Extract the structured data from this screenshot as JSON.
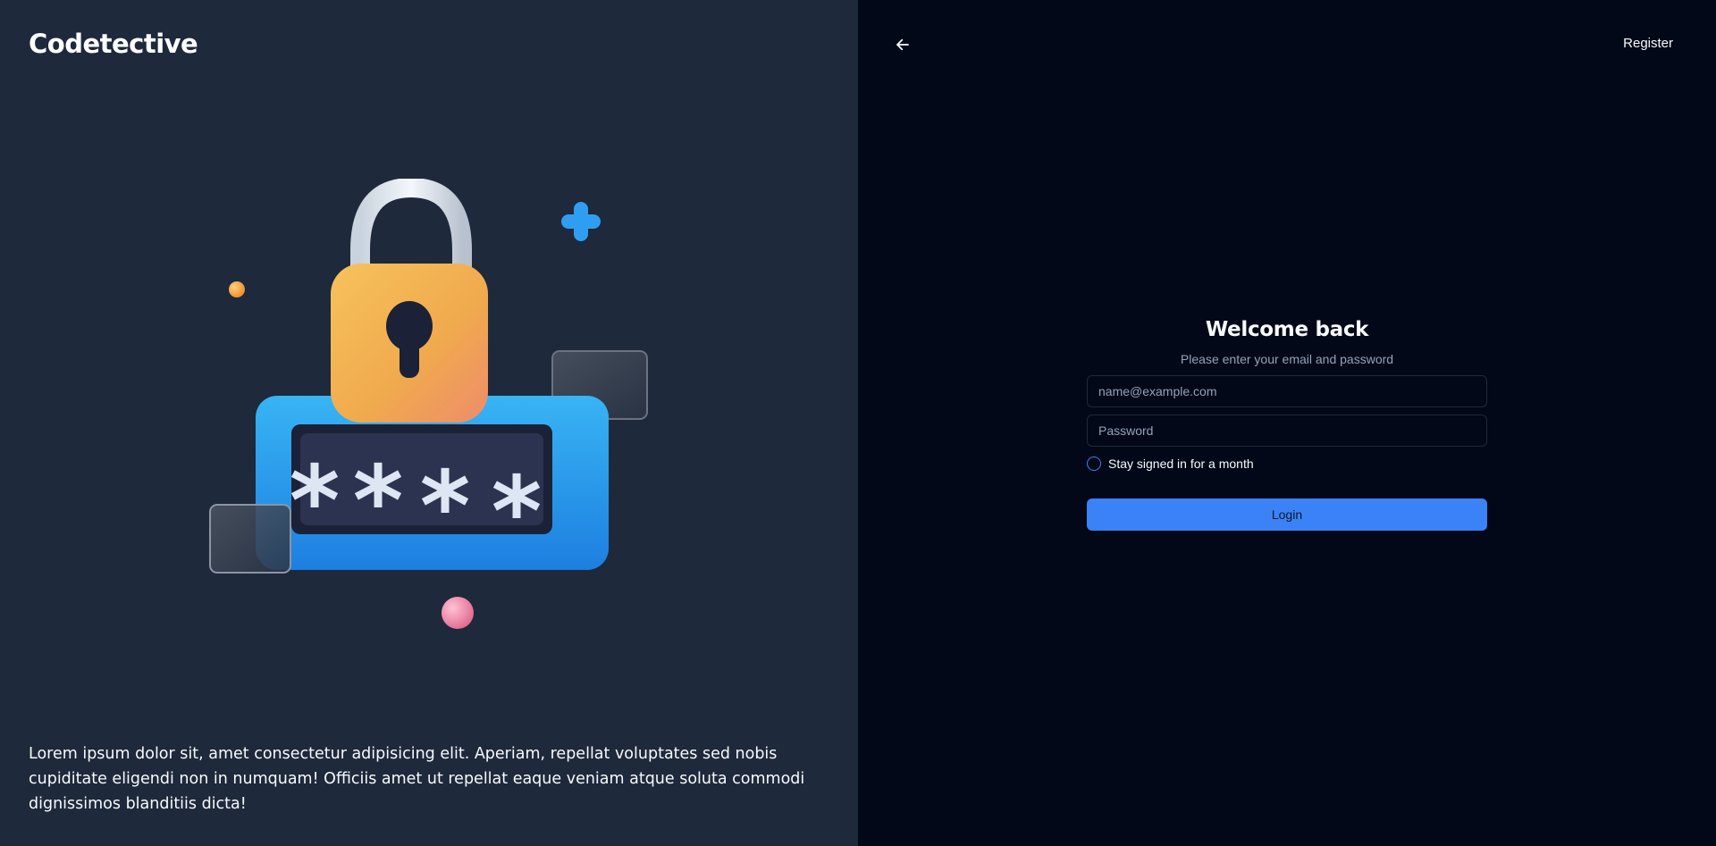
{
  "left_panel": {
    "brand": "Codetective",
    "illustration_icon": "padlock-password-icon",
    "quote": "Lorem ipsum dolor sit, amet consectetur adipisicing elit. Aperiam, repellat voluptates sed nobis cupiditate eligendi non in numquam! Officiis amet ut repellat eaque veniam atque soluta commodi dignissimos blanditiis dicta!"
  },
  "header": {
    "back_icon": "arrow-left-icon",
    "register_label": "Register"
  },
  "login_form": {
    "title": "Welcome back",
    "subtitle": "Please enter your email and password",
    "email_placeholder": "name@example.com",
    "password_placeholder": "Password",
    "remember_label": "Stay signed in for a month",
    "login_label": "Login"
  },
  "colors": {
    "left_background": "#1e293b",
    "right_background": "#020817",
    "accent": "#3b82f6",
    "muted_text": "#94a3b8"
  }
}
